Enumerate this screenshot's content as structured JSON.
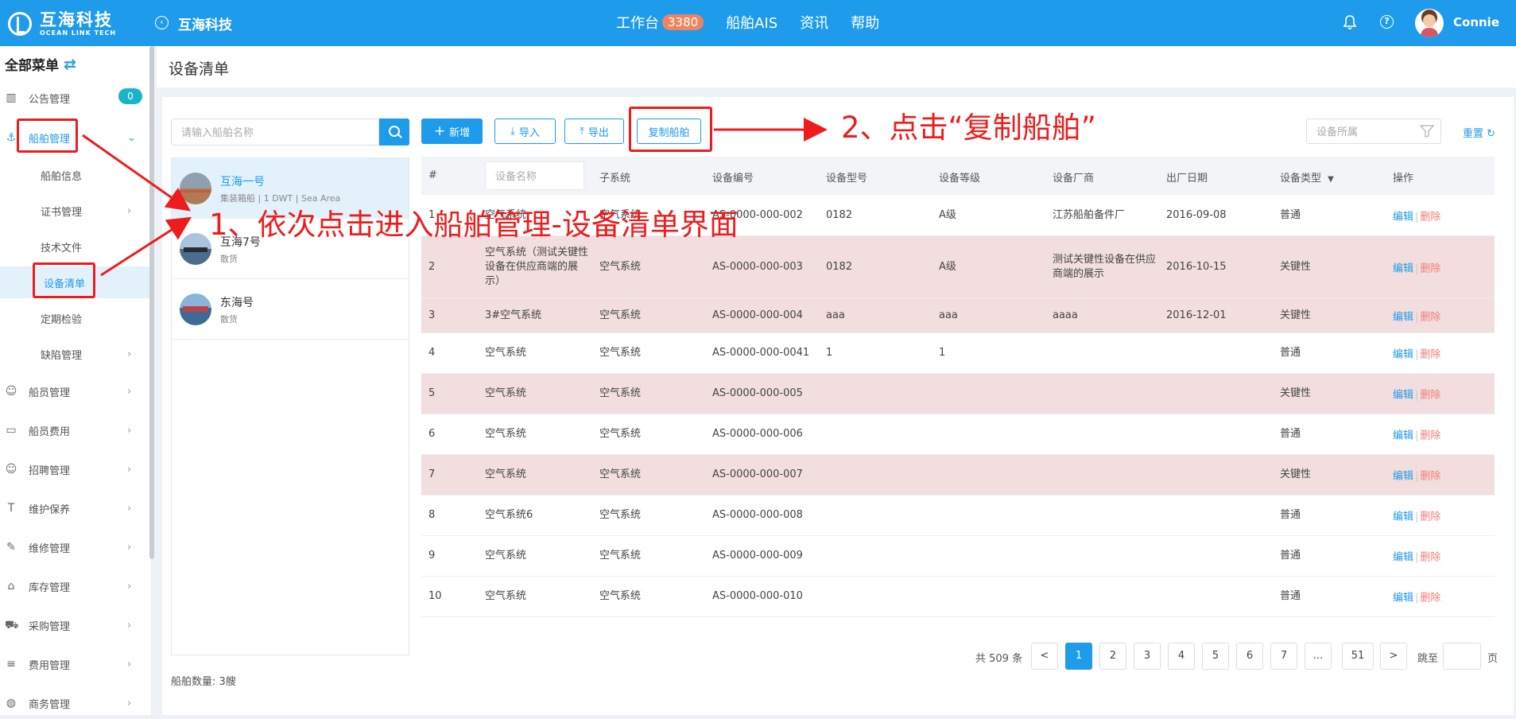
{
  "topbar": {
    "logo_cn": "互海科技",
    "logo_en": "OCEAN LINK TECH",
    "company": "互海科技",
    "nav": [
      {
        "label": "工作台",
        "badge": "3380"
      },
      {
        "label": "船舶AIS"
      },
      {
        "label": "资讯"
      },
      {
        "label": "帮助"
      }
    ],
    "user": "Connie"
  },
  "sidebar": {
    "title": "全部菜单",
    "notice": {
      "label": "公告管理",
      "count": "0"
    },
    "ship_mgmt": "船舶管理",
    "sub_items": [
      "船舶信息",
      "证书管理",
      "技术文件",
      "设备清单",
      "定期检验",
      "缺陷管理"
    ],
    "items": [
      "船员管理",
      "船员费用",
      "招聘管理",
      "维护保养",
      "维修管理",
      "库存管理",
      "采购管理",
      "费用管理",
      "商务管理"
    ]
  },
  "page": {
    "title": "设备清单"
  },
  "ships": {
    "search_placeholder": "请输入船舶名称",
    "list": [
      {
        "name": "互海一号",
        "desc": "集装箱船 | 1 DWT | Sea Area"
      },
      {
        "name": "互海7号",
        "desc": "散货"
      },
      {
        "name": "东海号",
        "desc": "散货"
      }
    ],
    "count_label": "船舶数量:",
    "count": "3艘"
  },
  "toolbar": {
    "add": "新增",
    "import": "导入",
    "export": "导出",
    "copy_ship": "复制船舶",
    "filter_placeholder": "设备所属",
    "reset": "重置"
  },
  "table": {
    "headers": [
      "#",
      "设备名称",
      "子系统",
      "设备编号",
      "设备型号",
      "设备等级",
      "设备厂商",
      "出厂日期",
      "设备类型",
      "操作"
    ],
    "edit": "编辑",
    "delete": "删除",
    "rows": [
      {
        "no": "1",
        "name": "空气系统",
        "sub": "空气系统",
        "code": "AS-0000-000-002",
        "model": "0182",
        "level": "A级",
        "maker": "江苏船舶备件厂",
        "date": "2016-09-08",
        "type": "普通",
        "key": false
      },
      {
        "no": "2",
        "name": "空气系统（测试关键性设备在供应商端的展示）",
        "sub": "空气系统",
        "code": "AS-0000-000-003",
        "model": "0182",
        "level": "A级",
        "maker": "测试关键性设备在供应商端的展示",
        "date": "2016-10-15",
        "type": "关键性",
        "key": true
      },
      {
        "no": "3",
        "name": "3#空气系统",
        "sub": "空气系统",
        "code": "AS-0000-000-004",
        "model": "aaa",
        "level": "aaa",
        "maker": "aaaa",
        "date": "2016-12-01",
        "type": "关键性",
        "key": true
      },
      {
        "no": "4",
        "name": "空气系统",
        "sub": "空气系统",
        "code": "AS-0000-000-0041",
        "model": "1",
        "level": "1",
        "maker": "",
        "date": "",
        "type": "普通",
        "key": false
      },
      {
        "no": "5",
        "name": "空气系统",
        "sub": "空气系统",
        "code": "AS-0000-000-005",
        "model": "",
        "level": "",
        "maker": "",
        "date": "",
        "type": "关键性",
        "key": true
      },
      {
        "no": "6",
        "name": "空气系统",
        "sub": "空气系统",
        "code": "AS-0000-000-006",
        "model": "",
        "level": "",
        "maker": "",
        "date": "",
        "type": "普通",
        "key": false
      },
      {
        "no": "7",
        "name": "空气系统",
        "sub": "空气系统",
        "code": "AS-0000-000-007",
        "model": "",
        "level": "",
        "maker": "",
        "date": "",
        "type": "关键性",
        "key": true
      },
      {
        "no": "8",
        "name": "空气系统6",
        "sub": "空气系统",
        "code": "AS-0000-000-008",
        "model": "",
        "level": "",
        "maker": "",
        "date": "",
        "type": "普通",
        "key": false
      },
      {
        "no": "9",
        "name": "空气系统",
        "sub": "空气系统",
        "code": "AS-0000-000-009",
        "model": "",
        "level": "",
        "maker": "",
        "date": "",
        "type": "普通",
        "key": false
      },
      {
        "no": "10",
        "name": "空气系统",
        "sub": "空气系统",
        "code": "AS-0000-000-010",
        "model": "",
        "level": "",
        "maker": "",
        "date": "",
        "type": "普通",
        "key": false
      }
    ]
  },
  "pagination": {
    "total": "共 509 条",
    "prev": "<",
    "pages": [
      "1",
      "2",
      "3",
      "4",
      "5",
      "6",
      "7",
      "...",
      "51"
    ],
    "next": ">",
    "jump_to": "跳至",
    "page_unit": "页"
  },
  "annotations": {
    "step1": "1、依次点击进入船舶管理-设备清单界面",
    "step2": "2、点击“复制船舶”"
  },
  "colors": {
    "primary": "#1e9bea",
    "key_row": "#f2dede",
    "annotation": "#ee1c1c",
    "badge": "#f0845f"
  }
}
